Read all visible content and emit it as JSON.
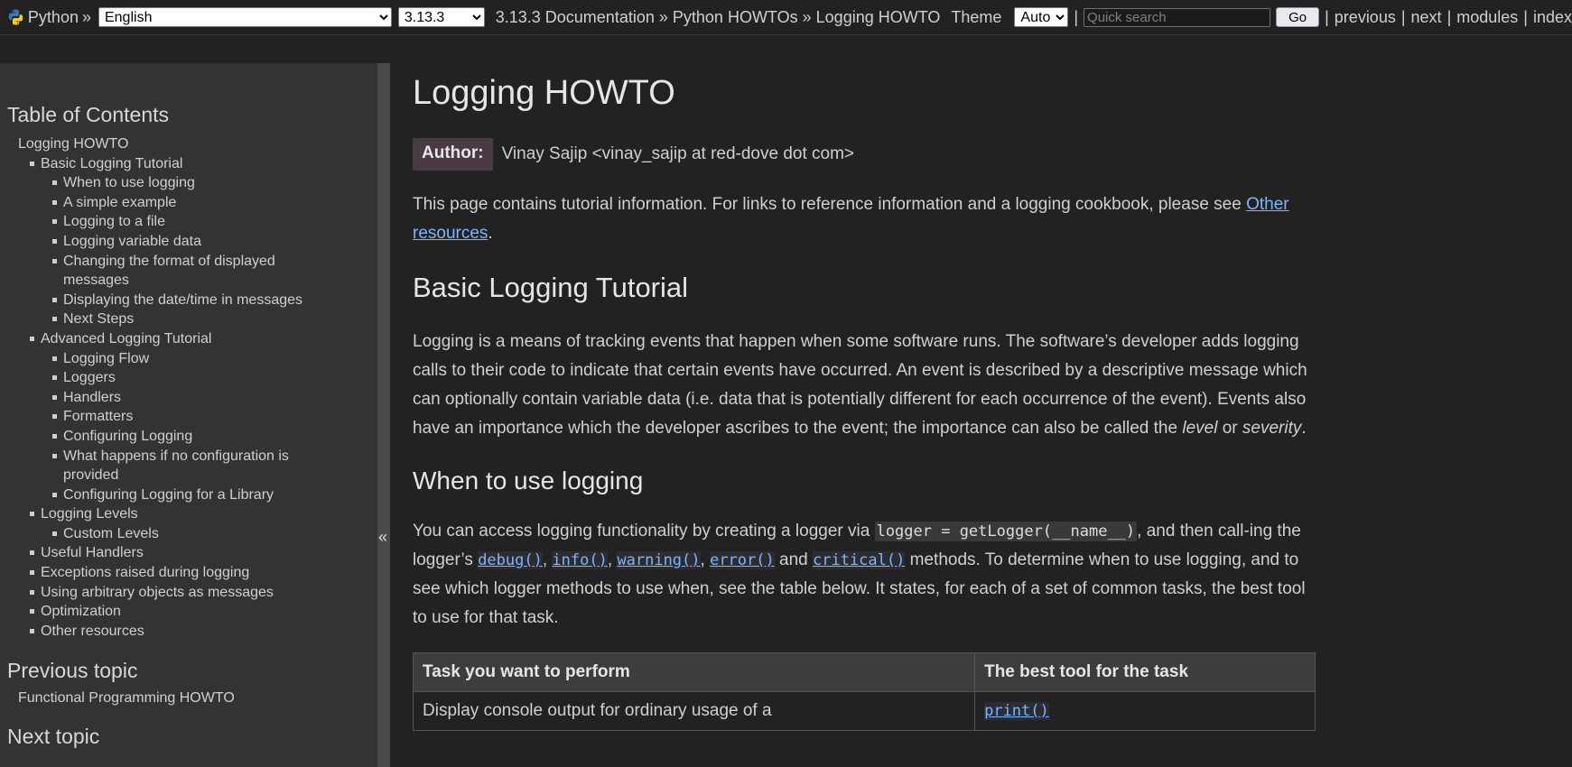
{
  "topbar": {
    "site_name": "Python",
    "sep": "»",
    "language": "English",
    "version": "3.13.3",
    "breadcrumbs": [
      "3.13.3 Documentation",
      "Python HOWTOs",
      "Logging HOWTO"
    ],
    "theme_label": "Theme",
    "theme_value": "Auto",
    "search_placeholder": "Quick search",
    "go_label": "Go",
    "pipe": "|",
    "nav": [
      "previous",
      "next",
      "modules",
      "index"
    ]
  },
  "sidebar": {
    "toc_heading": "Table of Contents",
    "toc": [
      {
        "level": 1,
        "label": "Logging HOWTO"
      },
      {
        "level": 2,
        "label": "Basic Logging Tutorial"
      },
      {
        "level": 3,
        "label": "When to use logging"
      },
      {
        "level": 3,
        "label": "A simple example"
      },
      {
        "level": 3,
        "label": "Logging to a file"
      },
      {
        "level": 3,
        "label": "Logging variable data"
      },
      {
        "level": 3,
        "label": "Changing the format of displayed messages"
      },
      {
        "level": 3,
        "label": "Displaying the date/time in messages"
      },
      {
        "level": 3,
        "label": "Next Steps"
      },
      {
        "level": 2,
        "label": "Advanced Logging Tutorial"
      },
      {
        "level": 3,
        "label": "Logging Flow"
      },
      {
        "level": 3,
        "label": "Loggers"
      },
      {
        "level": 3,
        "label": "Handlers"
      },
      {
        "level": 3,
        "label": "Formatters"
      },
      {
        "level": 3,
        "label": "Configuring Logging"
      },
      {
        "level": 3,
        "label": "What happens if no configuration is provided"
      },
      {
        "level": 3,
        "label": "Configuring Logging for a Library"
      },
      {
        "level": 2,
        "label": "Logging Levels"
      },
      {
        "level": 3,
        "label": "Custom Levels"
      },
      {
        "level": 2,
        "label": "Useful Handlers"
      },
      {
        "level": 2,
        "label": "Exceptions raised during logging"
      },
      {
        "level": 2,
        "label": "Using arbitrary objects as messages"
      },
      {
        "level": 2,
        "label": "Optimization"
      },
      {
        "level": 2,
        "label": "Other resources"
      }
    ],
    "prev_heading": "Previous topic",
    "prev_link": "Functional Programming HOWTO",
    "next_heading": "Next topic",
    "collapse_glyph": "«"
  },
  "main": {
    "title": "Logging HOWTO",
    "author_label": "Author:",
    "author_value": "Vinay Sajip <vinay_sajip at red-dove dot com>",
    "intro_text": "This page contains tutorial information. For links to reference information and a logging cookbook, please see",
    "intro_link": "Other resources",
    "intro_end": ".",
    "section1_title": "Basic Logging Tutorial",
    "section1_p_a": "Logging is a means of tracking events that happen when some software runs. The software’s developer adds logging calls to their code to indicate that certain events have occurred. An event is described by a descriptive message which can optionally contain variable data (i.e. data that is potentially different for each occurrence of the event). Events also have an importance which the developer ascribes to the event; the importance can also be called the",
    "section1_em1": "level",
    "section1_or": "or",
    "section1_em2": "severity",
    "section1_end": ".",
    "sub1_title": "When to use logging",
    "sub1_p_a": "You can access logging functionality by creating a logger via",
    "sub1_code": "logger = getLogger(__name__)",
    "sub1_p_b": ", and then call-ing the logger’s",
    "fn_debug": "debug()",
    "fn_info": "info()",
    "fn_warning": "warning()",
    "fn_error": "error()",
    "fn_critical": "critical()",
    "comma": ",",
    "and_word": "and",
    "sub1_p_c": "methods. To determine when to use logging, and to see which logger methods to use when, see the table below. It states, for each of a set of common tasks, the best tool to use for that task.",
    "table_head_task": "Task you want to perform",
    "table_head_tool": "The best tool for the task",
    "table_row1_task": "Display console output for ordinary usage of a",
    "table_row1_tool": "print()"
  }
}
